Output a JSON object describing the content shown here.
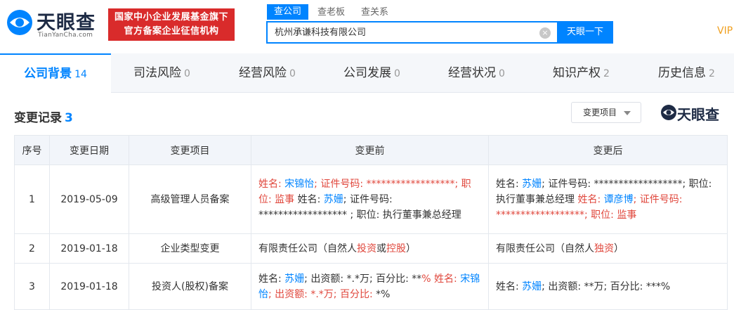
{
  "header": {
    "logo_text": "天眼查",
    "logo_sub": "TianYanCha.com",
    "slogan_line1": "国家中小企业发展基金旗下",
    "slogan_line2": "官方备案企业征信机构",
    "search_tabs": [
      "查公司",
      "查老板",
      "查关系"
    ],
    "search_value": "杭州承谦科技有限公司",
    "clear_symbol": "×",
    "search_button": "天眼一下",
    "vip": "VIP"
  },
  "tabs": [
    {
      "label": "公司背景",
      "count": "14"
    },
    {
      "label": "司法风险",
      "count": "0"
    },
    {
      "label": "经营风险",
      "count": "0"
    },
    {
      "label": "公司发展",
      "count": "0"
    },
    {
      "label": "经营状况",
      "count": "0"
    },
    {
      "label": "知识产权",
      "count": "2"
    },
    {
      "label": "历史信息",
      "count": "2"
    }
  ],
  "section": {
    "title": "变更记录",
    "count": "3",
    "filter_label": "变更项目",
    "watermark": "天眼查"
  },
  "table": {
    "headers": [
      "序号",
      "变更日期",
      "变更项目",
      "变更前",
      "变更后"
    ],
    "rows": [
      {
        "index": "1",
        "date": "2019-05-09",
        "item": "高级管理人员备案",
        "before": [
          {
            "t": "姓名: ",
            "c": "red"
          },
          {
            "t": "宋锦怡",
            "c": "blue"
          },
          {
            "t": "; 证件号码: ******************; 职位: 监事",
            "c": "red"
          },
          {
            "t": " 姓名: ",
            "c": ""
          },
          {
            "t": "苏姗",
            "c": "blue"
          },
          {
            "t": "; 证件号码: ****************** ; 职位: 执行董事兼总经理",
            "c": ""
          }
        ],
        "after": [
          {
            "t": "姓名: ",
            "c": ""
          },
          {
            "t": "苏姗",
            "c": "blue"
          },
          {
            "t": "; 证件号码: ******************; 职位: 执行董事兼总经理",
            "c": ""
          },
          {
            "t": " 姓名: ",
            "c": "red"
          },
          {
            "t": "谭彦博",
            "c": "blue"
          },
          {
            "t": "; 证件号码: ******************; 职位: 监事",
            "c": "red"
          }
        ]
      },
      {
        "index": "2",
        "date": "2019-01-18",
        "item": "企业类型变更",
        "before": [
          {
            "t": "有限责任公司（自然人",
            "c": ""
          },
          {
            "t": "投资",
            "c": "red"
          },
          {
            "t": "或",
            "c": ""
          },
          {
            "t": "控股",
            "c": "red"
          },
          {
            "t": "）",
            "c": ""
          }
        ],
        "after": [
          {
            "t": "有限责任公司（自然人",
            "c": ""
          },
          {
            "t": "独资",
            "c": "red"
          },
          {
            "t": "）",
            "c": ""
          }
        ]
      },
      {
        "index": "3",
        "date": "2019-01-18",
        "item": "投资人(股权)备案",
        "before": [
          {
            "t": "姓名: ",
            "c": ""
          },
          {
            "t": "苏姗",
            "c": "blue"
          },
          {
            "t": "; 出资额: *.*万; 百分比: **",
            "c": ""
          },
          {
            "t": "% 姓名: ",
            "c": "red"
          },
          {
            "t": "宋锦怡",
            "c": "blue"
          },
          {
            "t": "; 出资额: *.*万; 百分比: ",
            "c": "red"
          },
          {
            "t": "*%",
            "c": ""
          }
        ],
        "after": [
          {
            "t": "姓名: ",
            "c": ""
          },
          {
            "t": "苏姗",
            "c": "blue"
          },
          {
            "t": "; 出资额: **万; 百分比: ***%",
            "c": ""
          }
        ]
      }
    ]
  },
  "colors": {
    "accent": "#0084ff",
    "changed": "#e0473c",
    "slogan_bg": "#d92b2b"
  }
}
